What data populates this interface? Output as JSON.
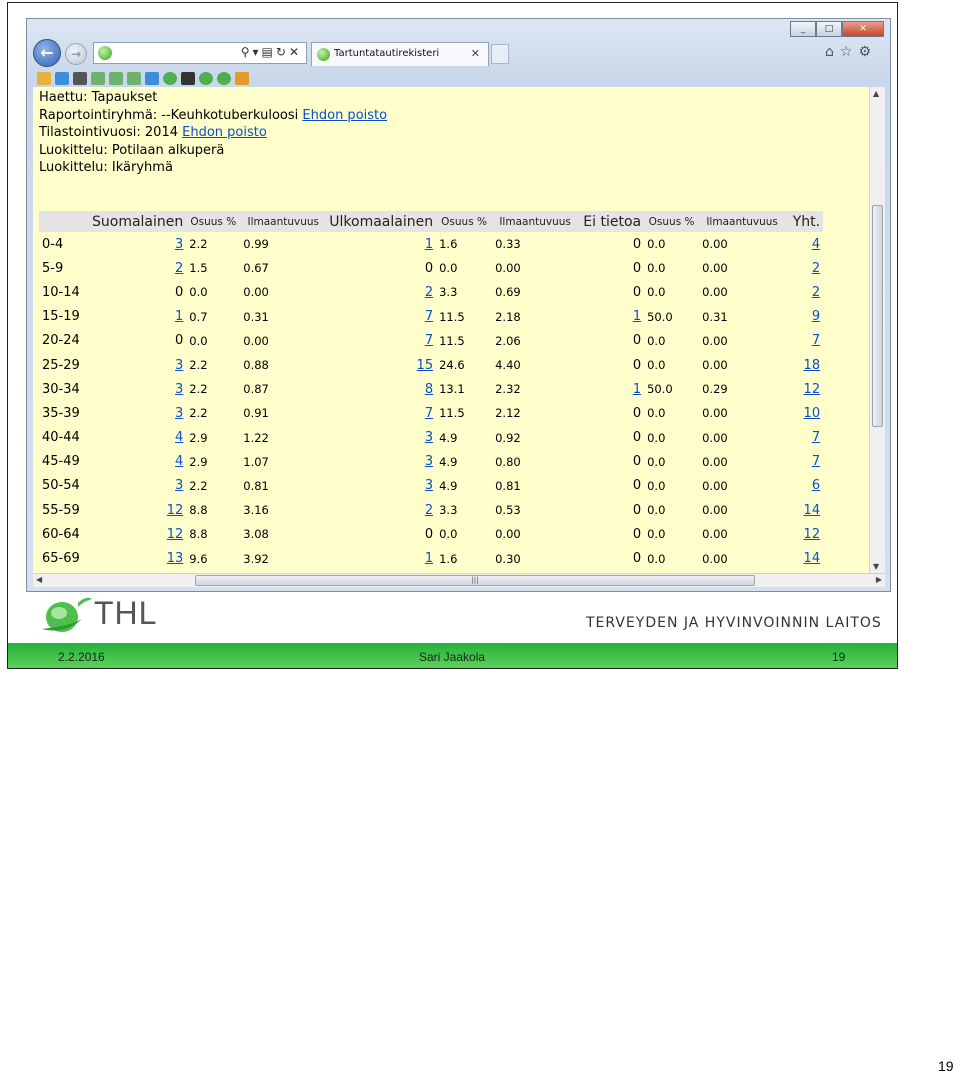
{
  "browser": {
    "tab_title": "Tartuntatautirekisteri",
    "window_buttons": [
      "_",
      "□",
      "✕"
    ]
  },
  "info_lines": {
    "l1": "Haettu: Tapaukset",
    "l2_text": "Raportointiryhmä: --Keuhkotuberkuloosi",
    "l2_link": "Ehdon poisto",
    "l3_text": "Tilastointivuosi: 2014",
    "l3_link": "Ehdon poisto",
    "l4": "Luokittelu: Potilaan alkuperä",
    "l5": "Luokittelu: Ikäryhmä"
  },
  "table": {
    "headers": [
      "",
      "Suomalainen",
      "Osuus %",
      "Ilmaantuvuus",
      "Ulkomaalainen",
      "Osuus %",
      "Ilmaantuvuus",
      "Ei tietoa",
      "Osuus %",
      "Ilmaantuvuus",
      "Yht."
    ],
    "rows": [
      [
        "0-4",
        "3",
        "2.2",
        "0.99",
        "1",
        "1.6",
        "0.33",
        "0",
        "0.0",
        "0.00",
        "4"
      ],
      [
        "5-9",
        "2",
        "1.5",
        "0.67",
        "0",
        "0.0",
        "0.00",
        "0",
        "0.0",
        "0.00",
        "2"
      ],
      [
        "10-14",
        "0",
        "0.0",
        "0.00",
        "2",
        "3.3",
        "0.69",
        "0",
        "0.0",
        "0.00",
        "2"
      ],
      [
        "15-19",
        "1",
        "0.7",
        "0.31",
        "7",
        "11.5",
        "2.18",
        "1",
        "50.0",
        "0.31",
        "9"
      ],
      [
        "20-24",
        "0",
        "0.0",
        "0.00",
        "7",
        "11.5",
        "2.06",
        "0",
        "0.0",
        "0.00",
        "7"
      ],
      [
        "25-29",
        "3",
        "2.2",
        "0.88",
        "15",
        "24.6",
        "4.40",
        "0",
        "0.0",
        "0.00",
        "18"
      ],
      [
        "30-34",
        "3",
        "2.2",
        "0.87",
        "8",
        "13.1",
        "2.32",
        "1",
        "50.0",
        "0.29",
        "12"
      ],
      [
        "35-39",
        "3",
        "2.2",
        "0.91",
        "7",
        "11.5",
        "2.12",
        "0",
        "0.0",
        "0.00",
        "10"
      ],
      [
        "40-44",
        "4",
        "2.9",
        "1.22",
        "3",
        "4.9",
        "0.92",
        "0",
        "0.0",
        "0.00",
        "7"
      ],
      [
        "45-49",
        "4",
        "2.9",
        "1.07",
        "3",
        "4.9",
        "0.80",
        "0",
        "0.0",
        "0.00",
        "7"
      ],
      [
        "50-54",
        "3",
        "2.2",
        "0.81",
        "3",
        "4.9",
        "0.81",
        "0",
        "0.0",
        "0.00",
        "6"
      ],
      [
        "55-59",
        "12",
        "8.8",
        "3.16",
        "2",
        "3.3",
        "0.53",
        "0",
        "0.0",
        "0.00",
        "14"
      ],
      [
        "60-64",
        "12",
        "8.8",
        "3.08",
        "0",
        "0.0",
        "0.00",
        "0",
        "0.0",
        "0.00",
        "12"
      ],
      [
        "65-69",
        "13",
        "9.6",
        "3.92",
        "1",
        "1.6",
        "0.30",
        "0",
        "0.0",
        "0.00",
        "14"
      ]
    ]
  },
  "logo_text": "THL",
  "org_name": "TERVEYDEN JA HYVINVOINNIN LAITOS",
  "footer": {
    "date": "2.2.2016",
    "author": "Sari Jaakola",
    "slide_number": "19"
  },
  "page_number": "19",
  "colors": {
    "content_bg": "#ffffcc",
    "link": "#0a4ec9",
    "footer_green": "#3cbf48",
    "header_bg": "#e4e4e4"
  }
}
